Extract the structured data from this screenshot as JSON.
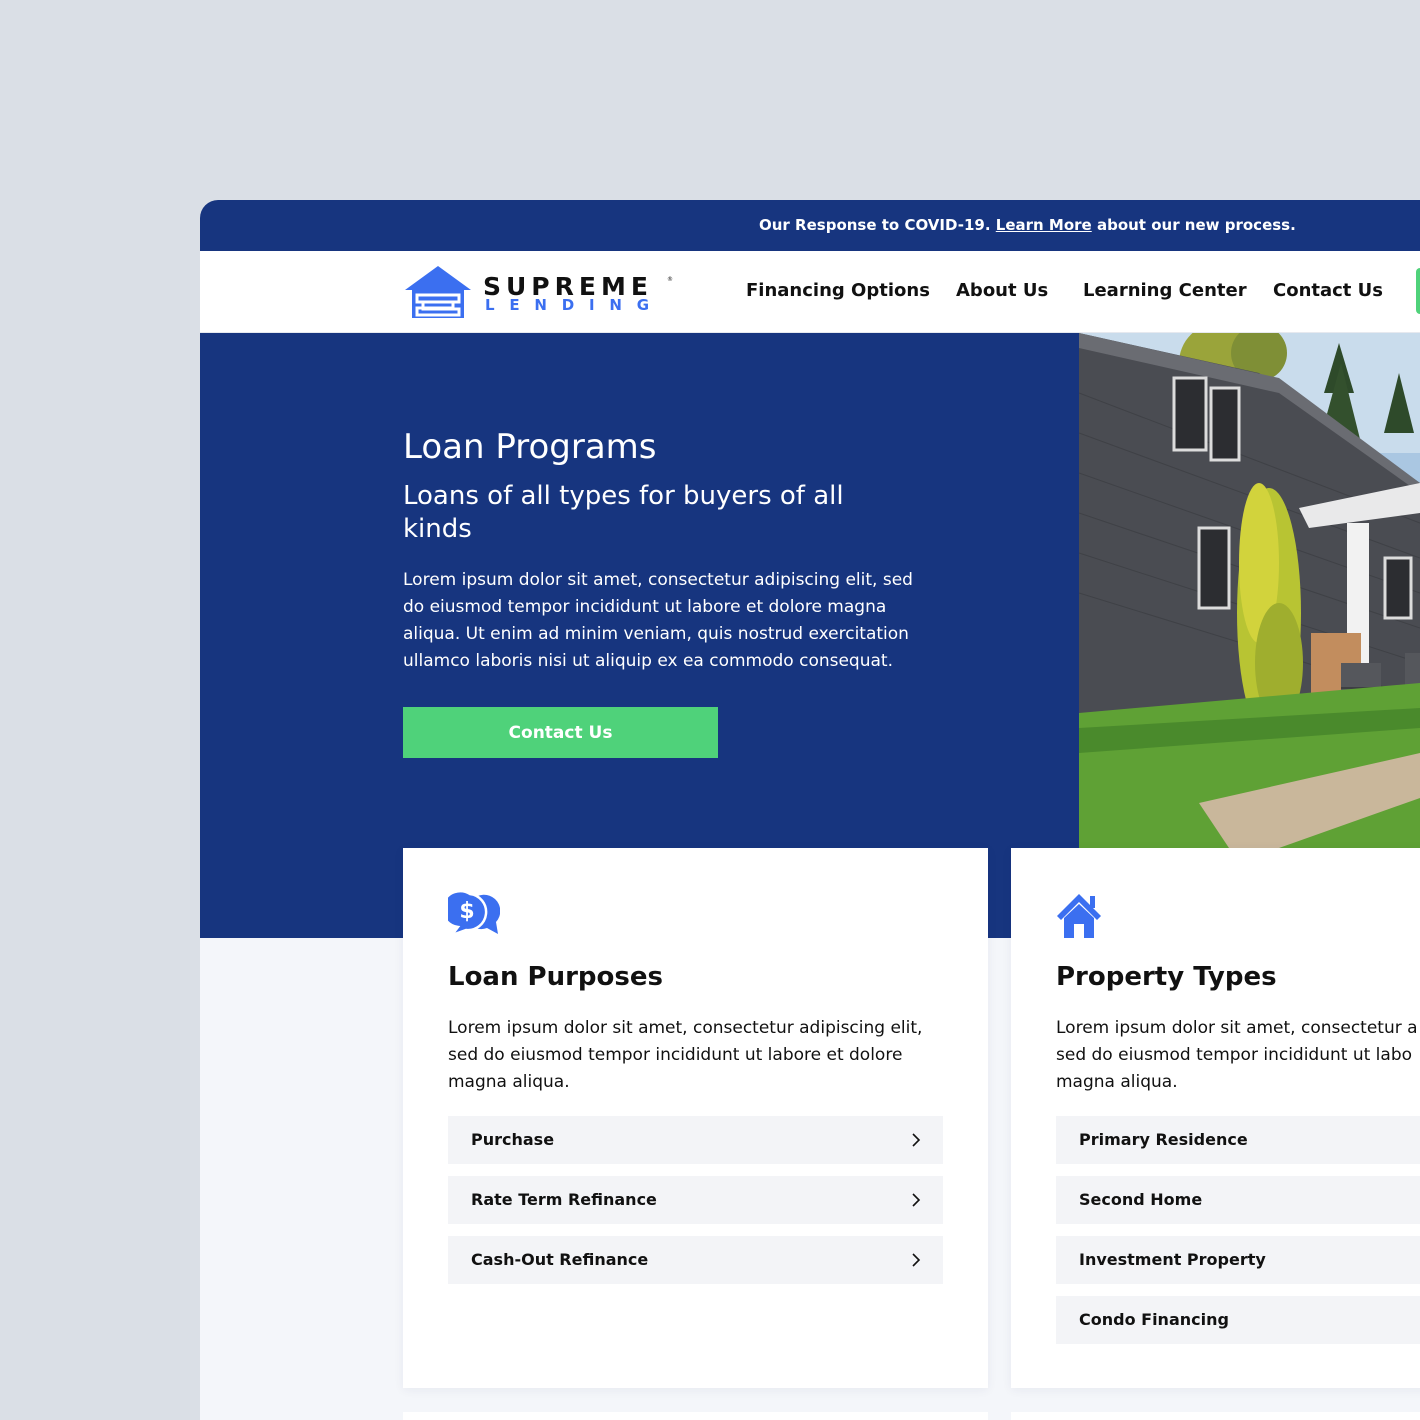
{
  "banner": {
    "text_before": "Our Response to COVID-19.",
    "link": "Learn More",
    "text_after": "about our new process."
  },
  "brand": {
    "name_line1": "SUPREME",
    "name_line2": "LENDING",
    "trademark": "®",
    "primary_color": "#17357f",
    "accent_color": "#3b6ff0",
    "cta_color": "#4fd27a"
  },
  "nav": {
    "items": [
      "Financing Options",
      "About Us",
      "Learning Center",
      "Contact Us"
    ]
  },
  "hero": {
    "title": "Loan Programs",
    "subtitle": "Loans of all types for buyers of all kinds",
    "body": "Lorem ipsum dolor sit amet, consectetur adipiscing elit, sed do eiusmod tempor incididunt ut labore et dolore magna aliqua. Ut enim ad minim veniam, quis nostrud exercitation ullamco laboris nisi ut aliquip ex ea commodo consequat.",
    "button": "Contact Us"
  },
  "cards": [
    {
      "icon": "dollar-chat-icon",
      "title": "Loan Purposes",
      "body": "Lorem ipsum dolor sit amet, consectetur adipiscing elit, sed do eiusmod tempor incididunt ut labore et dolore magna aliqua.",
      "items": [
        "Purchase",
        "Rate Term Refinance",
        "Cash-Out Refinance"
      ]
    },
    {
      "icon": "house-icon",
      "title": "Property Types",
      "body_lines": [
        "Lorem ipsum dolor sit amet, consectetur a",
        "sed do eiusmod tempor incididunt ut labo",
        "magna aliqua."
      ],
      "items": [
        "Primary Residence",
        "Second Home",
        "Investment Property",
        "Condo Financing"
      ]
    }
  ]
}
